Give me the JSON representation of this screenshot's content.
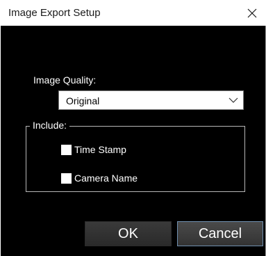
{
  "window": {
    "title": "Image Export Setup",
    "close_icon": "close-x-icon"
  },
  "quality": {
    "label": "Image Quality:",
    "selected": "Original",
    "chevron_icon": "chevron-down-icon"
  },
  "include": {
    "legend": "Include:",
    "options": [
      {
        "label": "Time Stamp",
        "checked": false
      },
      {
        "label": "Camera Name",
        "checked": false
      }
    ]
  },
  "buttons": {
    "ok_label": "OK",
    "cancel_label": "Cancel"
  },
  "colors": {
    "background": "#000000",
    "title_bar": "#ffffff",
    "text": "#ffffff"
  }
}
